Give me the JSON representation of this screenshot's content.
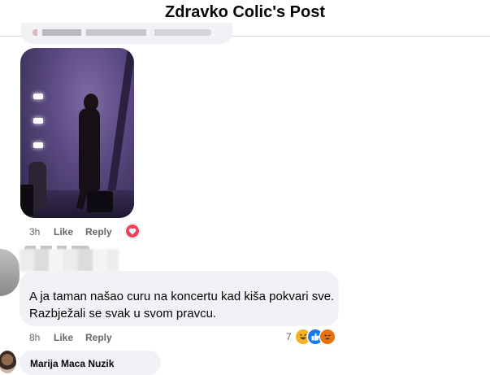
{
  "header": {
    "title": "Zdravko Colic's Post"
  },
  "photo_comment": {
    "time": "3h",
    "like_label": "Like",
    "reply_label": "Reply",
    "reaction_icon": "love-reaction-icon"
  },
  "comment": {
    "text_line1": "A ja taman našao curu na koncertu kad kiša pokvari sve.",
    "text_line2": "Razbježali se svak u svom pravcu.",
    "time": "8h",
    "like_label": "Like",
    "reply_label": "Reply",
    "reaction_count": "7",
    "reactions": [
      "haha-reaction-icon",
      "like-reaction-icon",
      "angry-reaction-icon"
    ]
  },
  "next_comment": {
    "author": "Marija Maca Nuzik"
  },
  "colors": {
    "link": "#65676b",
    "bubble": "#f0f2f5",
    "love": "#f33e58",
    "like": "#1877f2",
    "haha": "#f7b125",
    "angry": "#e9710f"
  }
}
